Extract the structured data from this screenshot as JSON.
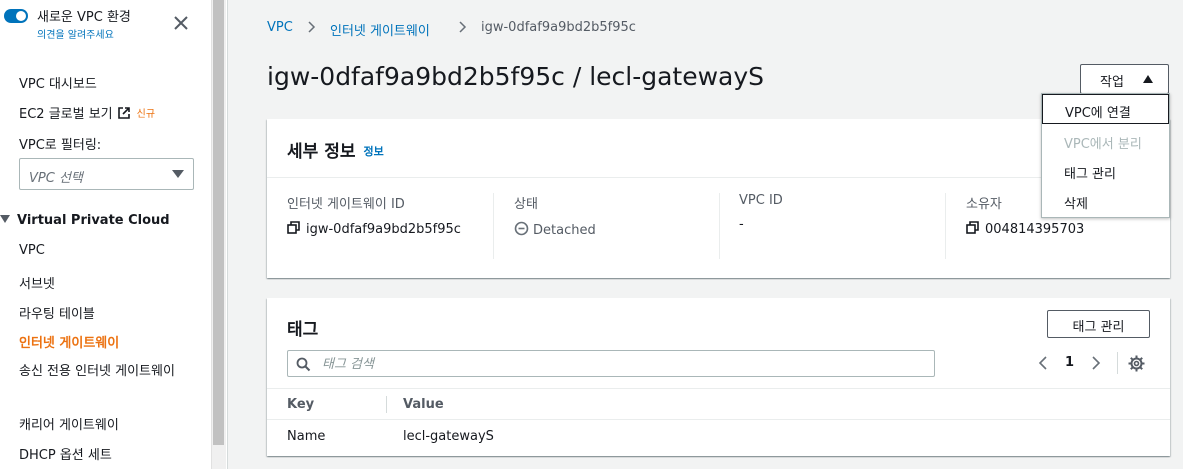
{
  "sidebar": {
    "new_env_title": "새로운 VPC 환경",
    "new_env_feedback": "의견을 알려주세요",
    "items_top": [
      {
        "label": "VPC 대시보드"
      },
      {
        "label": "EC2 글로벌 보기",
        "badge": "신규"
      }
    ],
    "filter_label": "VPC로 필터링:",
    "vpc_select_placeholder": "VPC 선택",
    "section_title": "Virtual Private Cloud",
    "section_items": [
      {
        "label": "VPC"
      },
      {
        "label": "서브넷"
      },
      {
        "label": "라우팅 테이블"
      },
      {
        "label": "인터넷 게이트웨이",
        "active": true
      },
      {
        "label": "송신 전용 인터넷 게이트웨이"
      },
      {
        "label": "캐리어 게이트웨이"
      },
      {
        "label": "DHCP 옵션 세트"
      }
    ]
  },
  "breadcrumb": {
    "items": [
      "VPC",
      "인터넷 게이트웨이",
      "igw-0dfaf9a9bd2b5f95c"
    ]
  },
  "page": {
    "title": "igw-0dfaf9a9bd2b5f95c / lecl-gatewayS"
  },
  "actions": {
    "label": "작업",
    "menu": [
      {
        "label": "VPC에 연결",
        "state": "highlighted"
      },
      {
        "label": "VPC에서 분리",
        "state": "disabled"
      },
      {
        "label": "태그 관리",
        "state": "enabled"
      },
      {
        "label": "삭제",
        "state": "enabled"
      }
    ]
  },
  "details": {
    "title": "세부 정보",
    "info_link": "정보",
    "fields": [
      {
        "label": "인터넷 게이트웨이 ID",
        "value": "igw-0dfaf9a9bd2b5f95c",
        "icon": "copy-icon"
      },
      {
        "label": "상태",
        "value": "Detached",
        "icon": "status-detached-icon"
      },
      {
        "label": "VPC ID",
        "value": "-"
      },
      {
        "label": "소유자",
        "value": "004814395703",
        "icon": "copy-icon"
      }
    ]
  },
  "tags": {
    "title": "태그",
    "manage_button": "태그 관리",
    "search_placeholder": "태그 검색",
    "page_number": "1",
    "columns": [
      "Key",
      "Value"
    ],
    "rows": [
      {
        "key": "Name",
        "value": "lecl-gatewayS"
      }
    ]
  },
  "colors": {
    "link": "#0073bb",
    "active_nav": "#ec7211",
    "toggle": "#0073bb"
  }
}
